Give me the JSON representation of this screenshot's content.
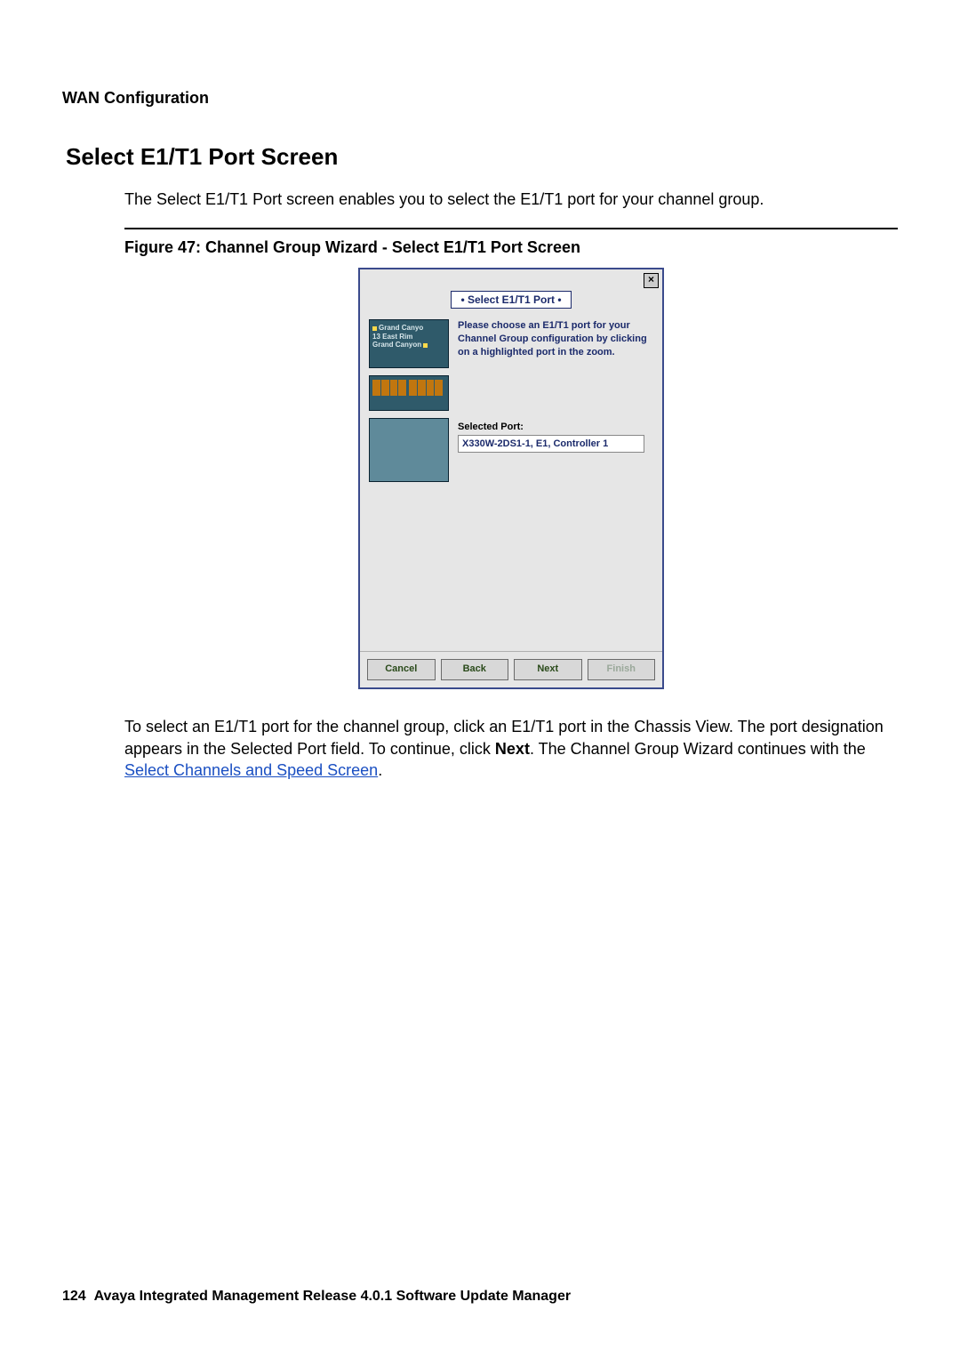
{
  "header": {
    "section": "WAN Configuration"
  },
  "heading": "Select E1/T1 Port Screen",
  "intro": "The Select E1/T1 Port screen enables you to select the E1/T1 port for your channel group.",
  "figure_caption": "Figure 47: Channel Group Wizard - Select E1/T1 Port Screen",
  "dialog": {
    "close_glyph": "×",
    "title": "• Select E1/T1 Port •",
    "instructions": "Please choose an E1/T1 port for your Channel Group configuration by clicking on a highlighted port in the zoom.",
    "chassis": {
      "module1": {
        "line1": "Grand Canyo",
        "line2": "East Rim",
        "line3": "Grand Canyon",
        "slot": "13"
      },
      "module2": {}
    },
    "selected_label": "Selected Port:",
    "selected_value": "X330W-2DS1-1, E1, Controller 1",
    "buttons": {
      "cancel": "Cancel",
      "back": "Back",
      "next": "Next",
      "finish": "Finish"
    }
  },
  "after": {
    "p1_a": "To select an E1/T1 port for the channel group, click an E1/T1 port in the Chassis View. The port designation appears in the Selected Port field. To continue, click ",
    "p1_bold": "Next",
    "p1_b": ". The Channel Group Wizard continues with the ",
    "link": "Select Channels and Speed Screen",
    "p1_c": "."
  },
  "footer": {
    "page": "124",
    "title": "Avaya Integrated Management Release 4.0.1 Software Update Manager"
  }
}
